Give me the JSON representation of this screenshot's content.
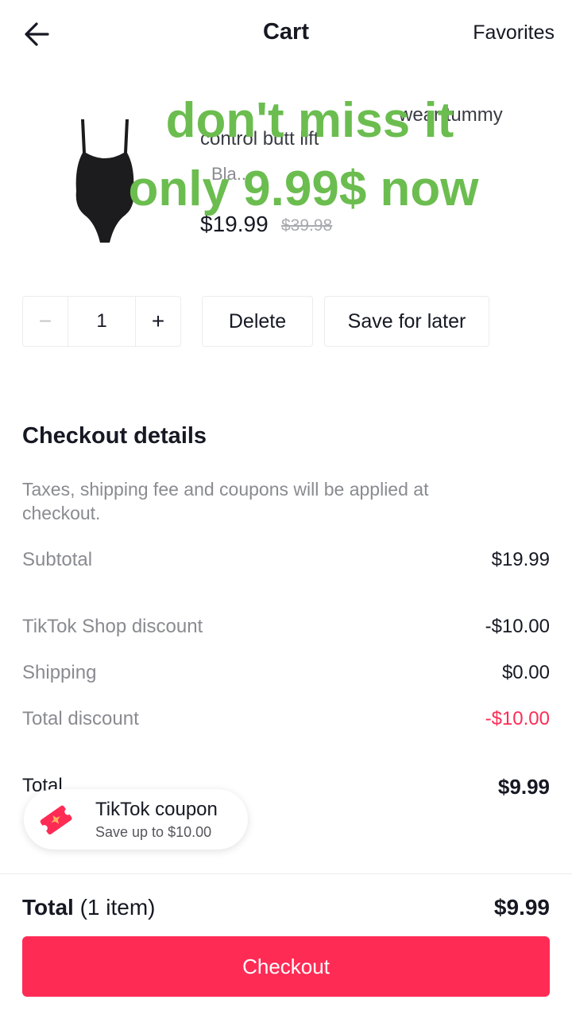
{
  "header": {
    "title": "Cart",
    "favorites_label": "Favorites"
  },
  "product": {
    "title_visible": "",
    "title_line1_right": "wear tummy",
    "title_line2": "control butt lift",
    "variant": "Bla...",
    "price": "$19.99",
    "original_price": "$39.98",
    "quantity": "1",
    "delete_label": "Delete",
    "save_label": "Save for later"
  },
  "overlay": {
    "line1": "don't miss it",
    "line2": "only 9.99$ now"
  },
  "checkout_details": {
    "title": "Checkout details",
    "note": "Taxes, shipping fee and coupons will be applied at checkout.",
    "rows": [
      {
        "label": "Subtotal",
        "value": "$19.99"
      },
      {
        "label": "TikTok Shop discount",
        "value": "-$10.00"
      },
      {
        "label": "Shipping",
        "value": "$0.00"
      },
      {
        "label": "Total discount",
        "value": "-$10.00"
      },
      {
        "label": "Total",
        "value": "$9.99"
      }
    ]
  },
  "coupon": {
    "title": "TikTok coupon",
    "subtitle": "Save up to $10.00"
  },
  "footer": {
    "total_label": "Total",
    "item_count": "(1 item)",
    "total_value": "$9.99",
    "checkout_label": "Checkout"
  },
  "colors": {
    "accent": "#fe2c55",
    "overlay_text": "#6bbd4f",
    "muted": "#8a8b91"
  }
}
